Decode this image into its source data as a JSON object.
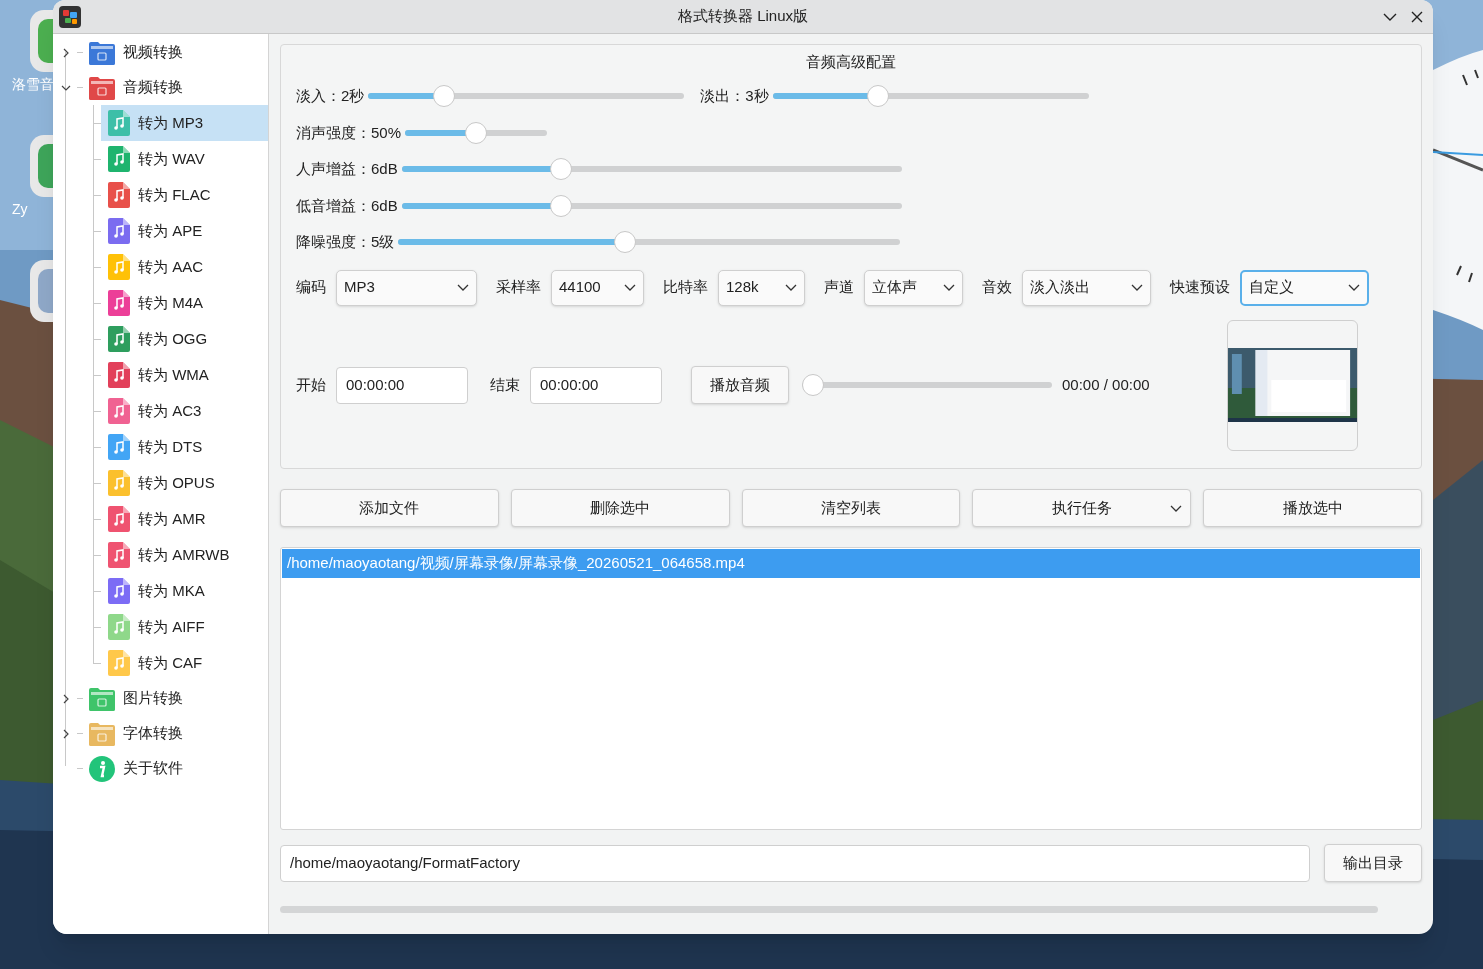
{
  "desktop": {
    "icons": [
      {
        "label": "洛雪音",
        "color": "#4caf50"
      },
      {
        "label": "Zy",
        "color": "#3ea55a"
      },
      {
        "color": "#8fa8c8"
      }
    ]
  },
  "window": {
    "title": "格式转换器 Linux版"
  },
  "tree": [
    {
      "label": "视频转换",
      "kind": "folder",
      "color": "#3b78d8",
      "expanded": false
    },
    {
      "label": "音频转换",
      "kind": "folder",
      "color": "#e04848",
      "expanded": true,
      "children": [
        {
          "label": "转为 MP3",
          "color": "#3dbfa8",
          "selected": true
        },
        {
          "label": "转为 WAV",
          "color": "#1fb46e",
          "selected": false
        },
        {
          "label": "转为 FLAC",
          "color": "#e8504a",
          "selected": false
        },
        {
          "label": "转为 APE",
          "color": "#7b6cf0",
          "selected": false
        },
        {
          "label": "转为 AAC",
          "color": "#ffc107",
          "selected": false
        },
        {
          "label": "转为 M4A",
          "color": "#ec3f98",
          "selected": false
        },
        {
          "label": "转为 OGG",
          "color": "#2e9e5e",
          "selected": false
        },
        {
          "label": "转为 WMA",
          "color": "#e2405a",
          "selected": false
        },
        {
          "label": "转为 AC3",
          "color": "#f06292",
          "selected": false
        },
        {
          "label": "转为 DTS",
          "color": "#42a5f5",
          "selected": false
        },
        {
          "label": "转为 OPUS",
          "color": "#fbc02d",
          "selected": false
        },
        {
          "label": "转为 AMR",
          "color": "#ef5370",
          "selected": false
        },
        {
          "label": "转为 AMRWB",
          "color": "#ef5371",
          "selected": false
        },
        {
          "label": "转为 MKA",
          "color": "#7c6cf5",
          "selected": false
        },
        {
          "label": "转为 AIFF",
          "color": "#8fd88a",
          "selected": false
        },
        {
          "label": "转为 CAF",
          "color": "#ffc84a",
          "selected": false
        }
      ]
    },
    {
      "label": "图片转换",
      "kind": "folder",
      "color": "#3fc46a",
      "expanded": false
    },
    {
      "label": "字体转换",
      "kind": "folder",
      "color": "#e8b860",
      "expanded": false
    },
    {
      "label": "关于软件",
      "kind": "info",
      "color": "#22c47a"
    }
  ],
  "config": {
    "title": "音频高级配置",
    "slider_rows": [
      [
        {
          "label": "淡入：2秒",
          "level": 0.22
        },
        {
          "label": "淡出：3秒",
          "level": 0.32
        }
      ],
      [
        {
          "label": "消声强度：50%",
          "level": 0.5
        }
      ],
      [
        {
          "label": "人声增益：6dB",
          "level": 0.31
        }
      ],
      [
        {
          "label": "低音增益：6dB",
          "level": 0.31
        }
      ],
      [
        {
          "label": "降噪强度：5级",
          "level": 0.45
        }
      ]
    ],
    "dropdowns": [
      {
        "label": "编码",
        "value": "MP3",
        "focused": false
      },
      {
        "label": "采样率",
        "value": "44100",
        "focused": false
      },
      {
        "label": "比特率",
        "value": "128k",
        "focused": false
      },
      {
        "label": "声道",
        "value": "立体声",
        "focused": false
      },
      {
        "label": "音效",
        "value": "淡入淡出",
        "focused": false
      },
      {
        "label": "快速预设",
        "value": "自定义",
        "focused": true
      }
    ],
    "start": {
      "label": "开始",
      "value": "00:00:00"
    },
    "end": {
      "label": "结束",
      "value": "00:00:00"
    },
    "play_button": "播放音频",
    "playback": {
      "level": 0,
      "time": "00:00 / 00:00"
    }
  },
  "actions": [
    {
      "label": "添加文件",
      "kind": "button"
    },
    {
      "label": "删除选中",
      "kind": "button"
    },
    {
      "label": "清空列表",
      "kind": "button"
    },
    {
      "label": "执行任务",
      "kind": "menu"
    },
    {
      "label": "播放选中",
      "kind": "button"
    }
  ],
  "files": [
    {
      "path": "/home/maoyaotang/视频/屏幕录像/屏幕录像_20260521_064658.mp4",
      "selected": true
    }
  ],
  "output": {
    "value": "/home/maoyaotang/FormatFactory",
    "button": "输出目录"
  },
  "progress": {
    "level": 0
  }
}
